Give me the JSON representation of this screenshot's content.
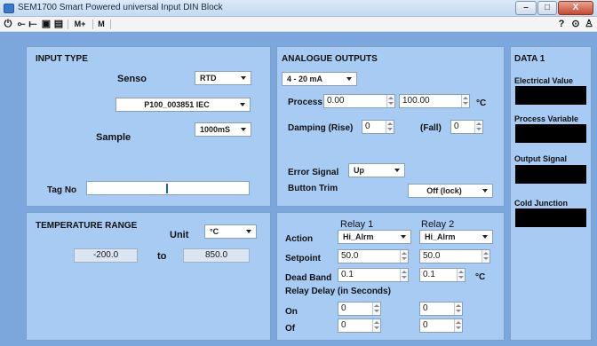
{
  "window": {
    "title": "SEM1700 Smart Powered universal Input DIN Block",
    "minimize": "–",
    "maximize": "□",
    "close": "X"
  },
  "toolbar": {
    "power": "⏻",
    "connect": "⟜",
    "disconnect": "⟝",
    "save": "▣",
    "open": "▤",
    "memory_add": "M+",
    "memory": "M",
    "help": "?",
    "target": "⊙",
    "user": "♙"
  },
  "input_type": {
    "header": "INPUT TYPE",
    "senso_label": "Senso",
    "senso_value": "RTD",
    "probe_value": "P100_003851 IEC",
    "sample_label": "Sample",
    "sample_value": "1000mS",
    "tag_label": "Tag No",
    "tag_value": ""
  },
  "temperature_range": {
    "header": "TEMPERATURE RANGE",
    "unit_label": "Unit",
    "unit_value": "°C",
    "low_value": "-200.0",
    "to_label": "to",
    "high_value": "850.0"
  },
  "analogue_outputs": {
    "header": "ANALOGUE  OUTPUTS",
    "range_value": "4 - 20 mA",
    "process_label": "Process",
    "process_low": "0.00",
    "process_high": "100.00",
    "process_unit": "°C",
    "damping_label": "Damping (Rise)",
    "damping_rise": "0",
    "fall_label": "(Fall)",
    "damping_fall": "0",
    "error_label": "Error Signal",
    "error_value": "Up",
    "trim_label": "Button Trim",
    "trim_value": "Off (lock)"
  },
  "relays": {
    "relay1_header": "Relay  1",
    "relay2_header": "Relay  2",
    "action_label": "Action",
    "action1": "Hi_Alrm",
    "action2": "Hi_Alrm",
    "setpoint_label": "Setpoint",
    "setpoint1": "50.0",
    "setpoint2": "50.0",
    "deadband_label": "Dead Band",
    "deadband1": "0.1",
    "deadband2": "0.1",
    "deadband_unit": "°C",
    "delay_label": "Relay Delay (in Seconds)",
    "on_label": "On",
    "on1": "0",
    "on2": "0",
    "off_label": "Of",
    "off1": "0",
    "off2": "0"
  },
  "data1": {
    "header": "DATA 1",
    "electrical_label": "Electrical Value",
    "process_var_label": "Process Variable",
    "output_label": "Output Signal",
    "cold_junction_label": "Cold Junction"
  }
}
